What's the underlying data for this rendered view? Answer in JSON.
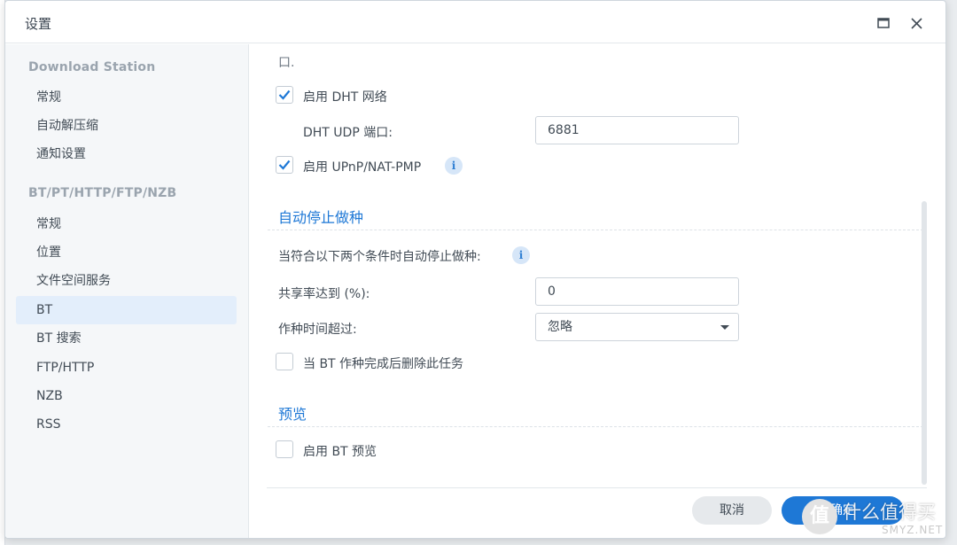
{
  "window": {
    "title": "设置",
    "maximize_icon": "maximize-icon",
    "close_icon": "close-icon"
  },
  "sidebar": {
    "group1_title": "Download Station",
    "group1_items": [
      "常规",
      "自动解压缩",
      "通知设置"
    ],
    "group2_title": "BT/PT/HTTP/FTP/NZB",
    "group2_items": [
      "常规",
      "位置",
      "文件空间服务",
      "BT",
      "BT 搜索",
      "FTP/HTTP",
      "NZB",
      "RSS"
    ],
    "active_item": "BT"
  },
  "content": {
    "cut_text": "口.",
    "dht": {
      "checkbox_label": "启用 DHT 网络",
      "checked": true,
      "port_label": "DHT UDP 端口:",
      "port_value": "6881"
    },
    "upnp": {
      "checkbox_label": "启用 UPnP/NAT-PMP",
      "checked": true,
      "info_icon": "info-icon"
    },
    "auto_stop": {
      "section_title": "自动停止做种",
      "description": "当符合以下两个条件时自动停止做种:",
      "ratio_label": "共享率达到 (%):",
      "ratio_value": "0",
      "time_label": "作种时间超过:",
      "time_value": "忽略",
      "delete_label": "当 BT 作种完成后删除此任务",
      "delete_checked": false
    },
    "preview": {
      "section_title": "预览",
      "checkbox_label": "启用 BT 预览",
      "checked": false
    }
  },
  "footer": {
    "cancel_label": "取消",
    "ok_label": "确定"
  },
  "watermark": {
    "logo_char": "值",
    "text": "什么值得买",
    "sub": "SMYZ.NET"
  },
  "colors": {
    "accent": "#1e78d6",
    "sidebar_bg": "#f5f7f9",
    "active_bg": "#e3eefb"
  }
}
